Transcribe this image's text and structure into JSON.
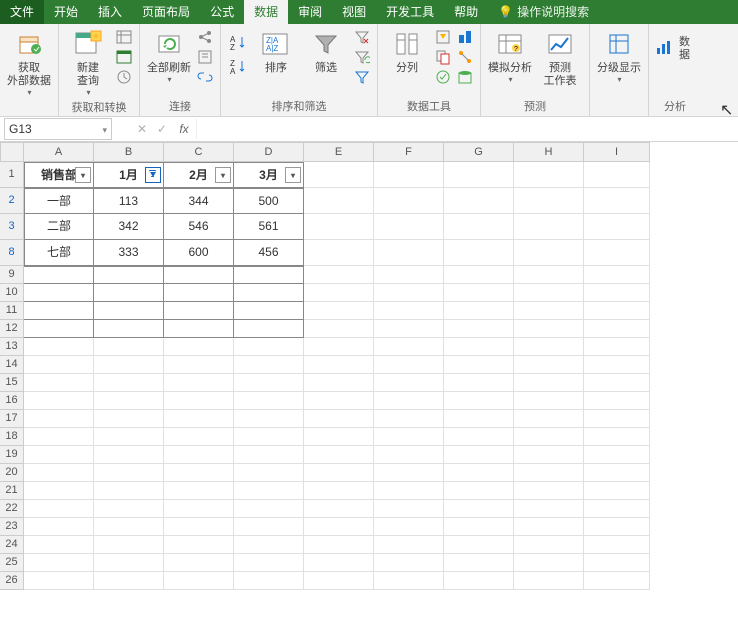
{
  "tabs": {
    "file": "文件",
    "home": "开始",
    "insert": "插入",
    "layout": "页面布局",
    "formulas": "公式",
    "data": "数据",
    "review": "审阅",
    "view": "视图",
    "dev": "开发工具",
    "help": "帮助",
    "search": "操作说明搜索"
  },
  "ribbon": {
    "get_data": "获取\n外部数据",
    "new_query": "新建\n查询",
    "refresh_all": "全部刷新",
    "sort": "排序",
    "filter": "筛选",
    "columns": "分列",
    "whatif": "模拟分析",
    "forecast": "预测\n工作表",
    "outline": "分级显示",
    "grp_get": "获取和转换",
    "grp_conn": "连接",
    "grp_sort": "排序和筛选",
    "grp_tools": "数据工具",
    "grp_forecast": "预测",
    "data_btn": "数据",
    "analysis": "分析"
  },
  "namebox": "G13",
  "columns": [
    "A",
    "B",
    "C",
    "D",
    "E",
    "F",
    "G",
    "H",
    "I"
  ],
  "headers": {
    "a": "销售部",
    "b": "1月",
    "c": "2月",
    "d": "3月"
  },
  "rows": [
    {
      "n": "2",
      "a": "一部",
      "b": "113",
      "c": "344",
      "d": "500"
    },
    {
      "n": "3",
      "a": "二部",
      "b": "342",
      "c": "546",
      "d": "561"
    },
    {
      "n": "8",
      "a": "七部",
      "b": "333",
      "c": "600",
      "d": "456"
    }
  ],
  "empty_rows": [
    "9",
    "10",
    "11",
    "12",
    "13",
    "14",
    "15",
    "16",
    "17",
    "18",
    "19",
    "20",
    "21",
    "22",
    "23",
    "24",
    "25",
    "26"
  ]
}
